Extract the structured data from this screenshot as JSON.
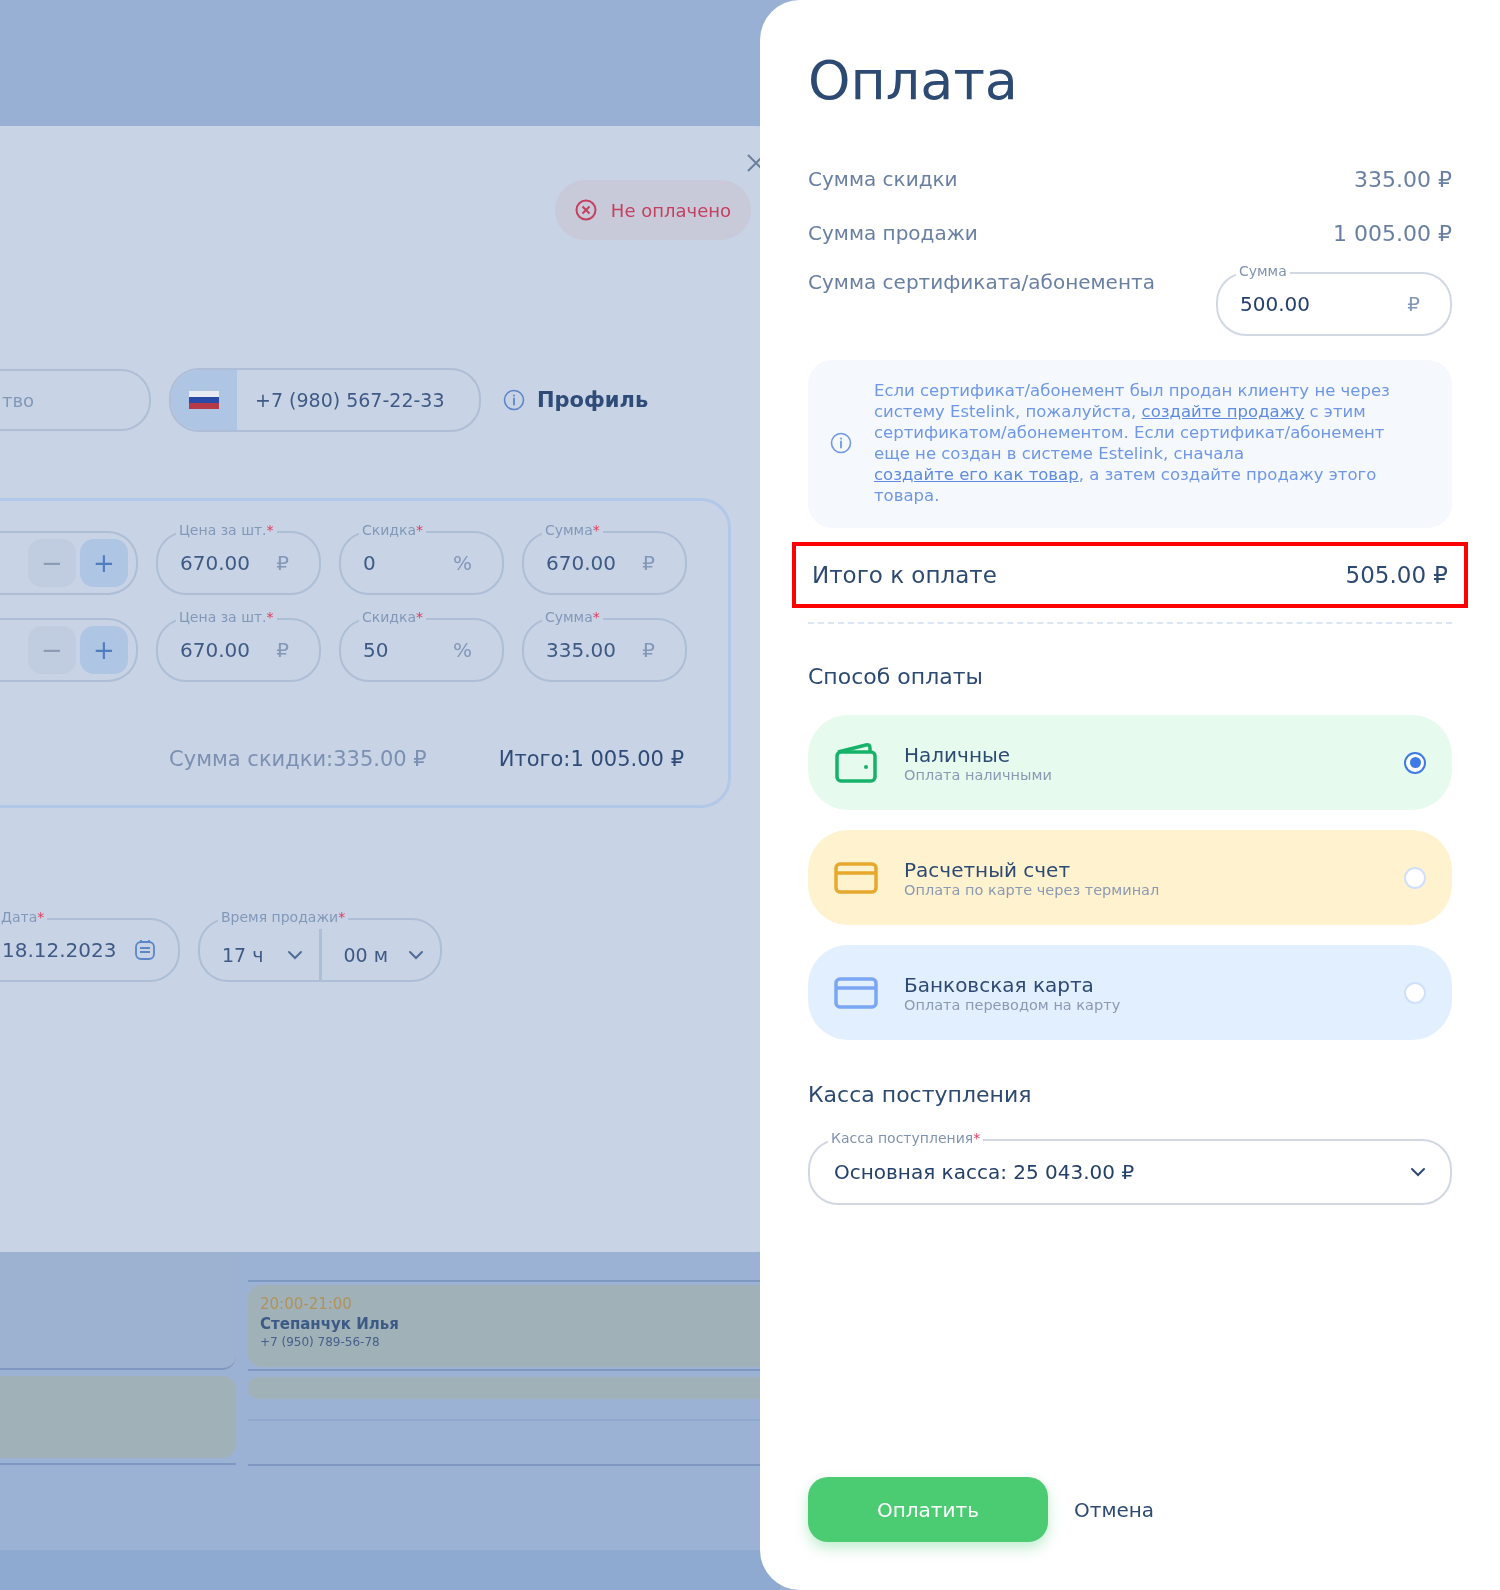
{
  "sale_modal": {
    "status_badge": "Не оплачено",
    "client": {
      "name_value": "тво",
      "phone": "+7 (980) 567-22-33",
      "profile_link": "Профиль"
    },
    "items": [
      {
        "fields": [
          {
            "label": "Цена за шт.",
            "required_mark": "*",
            "value": "670.00",
            "suffix": "₽"
          },
          {
            "label": "Скидка",
            "required_mark": "*",
            "value": "0",
            "suffix": "%"
          },
          {
            "label": "Сумма",
            "required_mark": "*",
            "value": "670.00",
            "suffix": "₽"
          }
        ]
      },
      {
        "fields": [
          {
            "label": "Цена за шт.",
            "required_mark": "*",
            "value": "670.00",
            "suffix": "₽"
          },
          {
            "label": "Скидка",
            "required_mark": "*",
            "value": "50",
            "suffix": "%"
          },
          {
            "label": "Сумма",
            "required_mark": "*",
            "value": "335.00",
            "suffix": "₽"
          }
        ]
      }
    ],
    "stepper": {
      "minus": "−",
      "plus": "+"
    },
    "discount_total": {
      "label": "Сумма скидки:",
      "value": "335.00 ₽"
    },
    "grand_total": {
      "label": "Итого:",
      "value": "1 005.00 ₽"
    },
    "date": {
      "label": "Дата",
      "required_mark": "*",
      "value": "18.12.2023"
    },
    "time": {
      "label": "Время продажи",
      "required_mark": "*",
      "hours": "17 ч",
      "minutes": "00 м"
    }
  },
  "calendar": {
    "events": [
      {
        "time": "20:00-21:00",
        "name": "Степанчук Илья",
        "phone": "+7 (950) 789-56-78"
      }
    ]
  },
  "payment": {
    "title": "Оплата",
    "summary": [
      {
        "label": "Сумма скидки",
        "value": "335.00 ₽"
      },
      {
        "label": "Сумма продажи",
        "value": "1 005.00 ₽"
      }
    ],
    "certificate": {
      "label": "Сумма сертификата/абонемента",
      "field_label": "Сумма",
      "value": "500.00",
      "suffix": "₽"
    },
    "notice": [
      {
        "text": "Если сертификат/абонемент был продан клиенту не через систему Estelink, пожалуйста, ",
        "link": false
      },
      {
        "text": "создайте продажу",
        "link": true
      },
      {
        "text": " с этим сертификатом/абонементом. Если сертификат/абонемент еще не создан в системе Estelink, сначала ",
        "link": false
      },
      {
        "text": "создайте его как товар",
        "link": true
      },
      {
        "text": ", а затем создайте продажу этого товара.",
        "link": false
      }
    ],
    "total": {
      "label": "Итого к оплате",
      "value": "505.00 ₽",
      "highlighted": true
    },
    "methods_title": "Способ оплаты",
    "methods": [
      {
        "kind": "wallet",
        "title": "Наличные",
        "subtitle": "Оплата наличными",
        "selected": true,
        "color": "#e6fbee"
      },
      {
        "kind": "card",
        "title": "Расчетный счет",
        "subtitle": "Оплата по карте через терминал",
        "selected": false,
        "color": "#fff2cf"
      },
      {
        "kind": "card",
        "title": "Банковская карта",
        "subtitle": "Оплата переводом на карту",
        "selected": false,
        "color": "#e2effe"
      }
    ],
    "cashbox": {
      "title": "Касса поступления",
      "field_label": "Касса поступления",
      "required_mark": "*",
      "value": "Основная касса: 25 043.00 ₽"
    },
    "buttons": {
      "pay": "Оплатить",
      "cancel": "Отмена"
    }
  }
}
